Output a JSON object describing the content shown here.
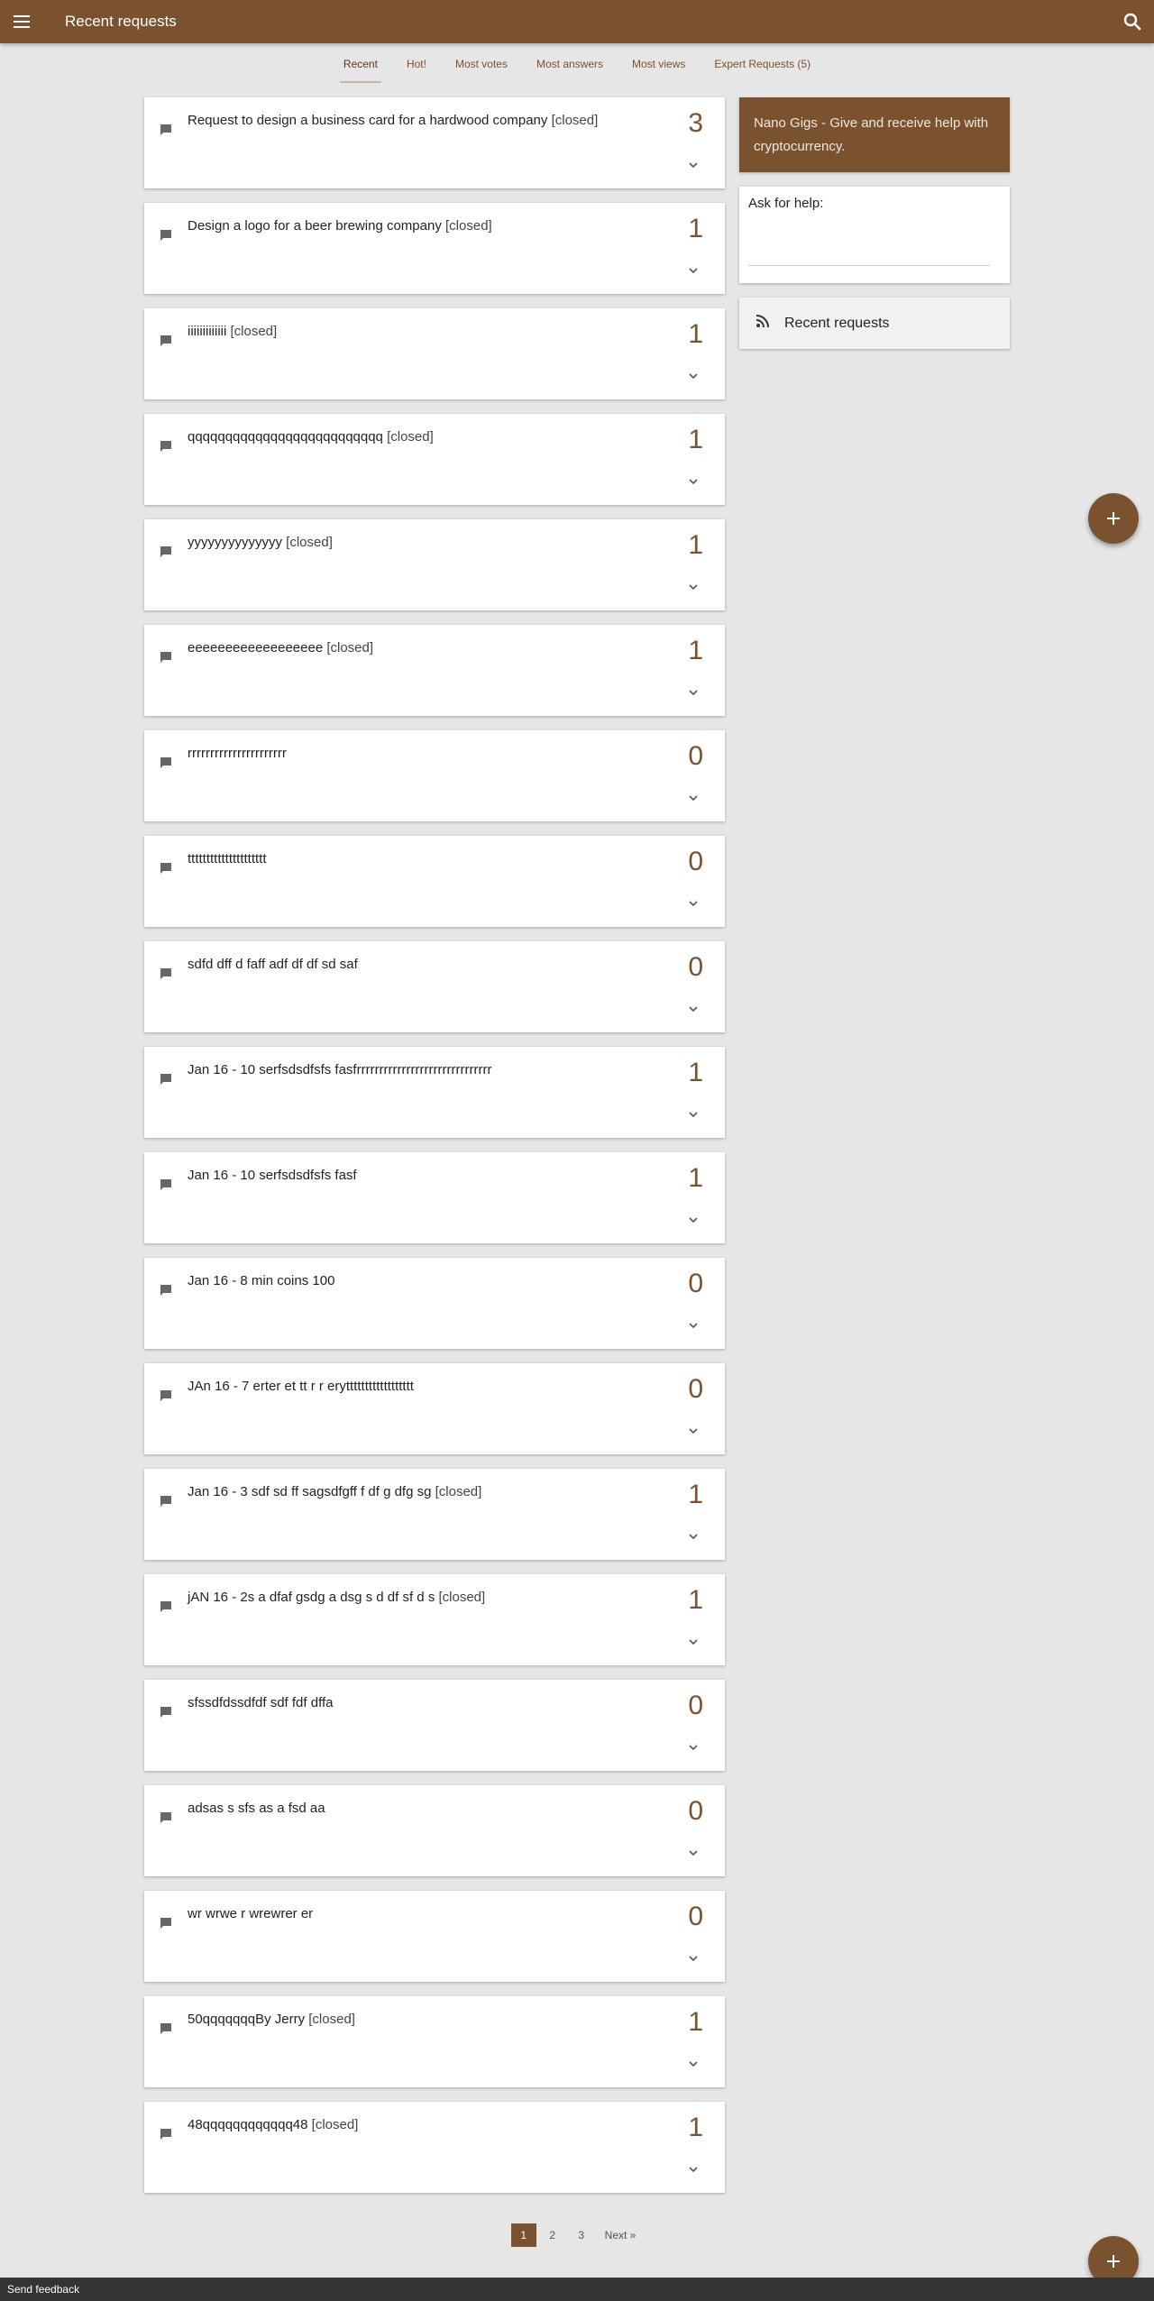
{
  "app": {
    "title": "Recent requests"
  },
  "tabs": [
    {
      "label": "Recent",
      "active": true
    },
    {
      "label": "Hot!"
    },
    {
      "label": "Most votes"
    },
    {
      "label": "Most answers"
    },
    {
      "label": "Most views"
    },
    {
      "label": "Expert Requests (5)"
    }
  ],
  "requests": [
    {
      "title": "Request to design a business card for a hardwood company",
      "status": "[closed]",
      "count": "3"
    },
    {
      "title": "Design a logo for a beer brewing company",
      "status": "[closed]",
      "count": "1"
    },
    {
      "title": "iiiiiiiiiiiii",
      "status": "[closed]",
      "count": "1"
    },
    {
      "title": "qqqqqqqqqqqqqqqqqqqqqqqqqq",
      "status": "[closed]",
      "count": "1"
    },
    {
      "title": "yyyyyyyyyyyyyy",
      "status": "[closed]",
      "count": "1"
    },
    {
      "title": "eeeeeeeeeeeeeeeeee",
      "status": "[closed]",
      "count": "1"
    },
    {
      "title": "rrrrrrrrrrrrrrrrrrrrrr",
      "status": "",
      "count": "0"
    },
    {
      "title": "ttttttttttttttttttttt",
      "status": "",
      "count": "0"
    },
    {
      "title": "sdfd dff d faff adf df df sd saf",
      "status": "",
      "count": "0"
    },
    {
      "title": "Jan 16 - 10 serfsdsdfsfs fasfrrrrrrrrrrrrrrrrrrrrrrrrrrrrrr",
      "status": "",
      "count": "1"
    },
    {
      "title": "Jan 16 - 10 serfsdsdfsfs fasf",
      "status": "",
      "count": "1"
    },
    {
      "title": "Jan 16 - 8 min coins 100",
      "status": "",
      "count": "0"
    },
    {
      "title": "JAn 16 - 7 erter et tt r r erytttttttttttttttttt",
      "status": "",
      "count": "0"
    },
    {
      "title": "Jan 16 - 3 sdf sd ff sagsdfgff f df g dfg sg",
      "status": "[closed]",
      "count": "1"
    },
    {
      "title": "jAN 16 - 2s a dfaf gsdg a dsg s d df sf d s",
      "status": "[closed]",
      "count": "1"
    },
    {
      "title": "sfssdfdssdfdf sdf fdf dffa",
      "status": "",
      "count": "0"
    },
    {
      "title": "adsas s sfs as a fsd aa",
      "status": "",
      "count": "0"
    },
    {
      "title": "wr wrwe r wrewrer er",
      "status": "",
      "count": "0"
    },
    {
      "title": "50qqqqqqqBy Jerry",
      "status": "[closed]",
      "count": "1"
    },
    {
      "title": "48qqqqqqqqqqqq48",
      "status": "[closed]",
      "count": "1"
    }
  ],
  "sidebar": {
    "promo": "Nano Gigs - Give and receive help with cryptocurrency.",
    "ask_label": "Ask for help:",
    "ask_placeholder": "",
    "rss_label": "Recent requests"
  },
  "pagination": {
    "pages": [
      "1",
      "2",
      "3"
    ],
    "current": "1",
    "next": "Next »"
  },
  "footer": {
    "feedback": "Send feedback"
  },
  "colors": {
    "brand": "#7a5230",
    "background": "#e6e6e6"
  },
  "icons": {
    "menu": "menu-icon",
    "search": "search-icon",
    "chat": "chat-bubble-icon",
    "expand": "chevron-down-icon",
    "rss": "rss-icon",
    "add": "plus-icon"
  }
}
